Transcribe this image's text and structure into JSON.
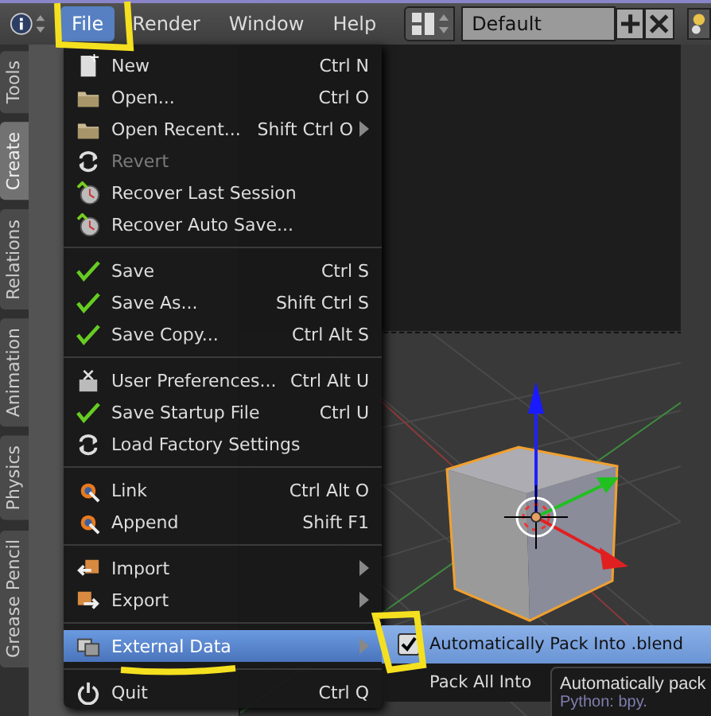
{
  "menubar": {
    "items": [
      {
        "label": "File",
        "selected": true
      },
      {
        "label": "Render",
        "selected": false
      },
      {
        "label": "Window",
        "selected": false
      },
      {
        "label": "Help",
        "selected": false
      }
    ]
  },
  "layout_field": {
    "value": "Default"
  },
  "tool_tabs": [
    {
      "label": "Tools",
      "selected": false
    },
    {
      "label": "Create",
      "selected": true
    },
    {
      "label": "Relations",
      "selected": false
    },
    {
      "label": "Animation",
      "selected": false
    },
    {
      "label": "Physics",
      "selected": false
    },
    {
      "label": "Grease Pencil",
      "selected": false
    }
  ],
  "file_menu": {
    "groups": [
      [
        {
          "label": "New",
          "shortcut": "Ctrl N",
          "disabled": false,
          "selected": false,
          "submenu": false
        },
        {
          "label": "Open...",
          "shortcut": "Ctrl O",
          "disabled": false,
          "selected": false,
          "submenu": false
        },
        {
          "label": "Open Recent...",
          "shortcut": "Shift Ctrl O",
          "disabled": false,
          "selected": false,
          "submenu": true
        },
        {
          "label": "Revert",
          "disabled": true,
          "selected": false,
          "submenu": false
        },
        {
          "label": "Recover Last Session",
          "disabled": false,
          "selected": false,
          "submenu": false
        },
        {
          "label": "Recover Auto Save...",
          "disabled": false,
          "selected": false,
          "submenu": false
        }
      ],
      [
        {
          "label": "Save",
          "shortcut": "Ctrl S",
          "disabled": false,
          "selected": false,
          "submenu": false
        },
        {
          "label": "Save As...",
          "shortcut": "Shift Ctrl S",
          "disabled": false,
          "selected": false,
          "submenu": false
        },
        {
          "label": "Save Copy...",
          "shortcut": "Ctrl Alt S",
          "disabled": false,
          "selected": false,
          "submenu": false
        }
      ],
      [
        {
          "label": "User Preferences...",
          "shortcut": "Ctrl Alt U",
          "disabled": false,
          "selected": false,
          "submenu": false
        },
        {
          "label": "Save Startup File",
          "shortcut": "Ctrl U",
          "disabled": false,
          "selected": false,
          "submenu": false
        },
        {
          "label": "Load Factory Settings",
          "disabled": false,
          "selected": false,
          "submenu": false
        }
      ],
      [
        {
          "label": "Link",
          "shortcut": "Ctrl Alt O",
          "disabled": false,
          "selected": false,
          "submenu": false
        },
        {
          "label": "Append",
          "shortcut": "Shift F1",
          "disabled": false,
          "selected": false,
          "submenu": false
        }
      ],
      [
        {
          "label": "Import",
          "disabled": false,
          "selected": false,
          "submenu": true
        },
        {
          "label": "Export",
          "disabled": false,
          "selected": false,
          "submenu": true
        }
      ],
      [
        {
          "label": "External Data",
          "disabled": false,
          "selected": true,
          "submenu": true
        }
      ],
      [
        {
          "label": "Quit",
          "shortcut": "Ctrl Q",
          "disabled": false,
          "selected": false,
          "submenu": false
        }
      ]
    ]
  },
  "submenu": {
    "items": [
      {
        "label": "Automatically Pack Into .blend",
        "kind": "toggle",
        "checked": true,
        "selected": true
      },
      {
        "label": "Pack All Into",
        "kind": "action",
        "selected": false
      }
    ]
  },
  "tooltip": {
    "lines": [
      "Automatically pack",
      "Python: bpy."
    ]
  }
}
